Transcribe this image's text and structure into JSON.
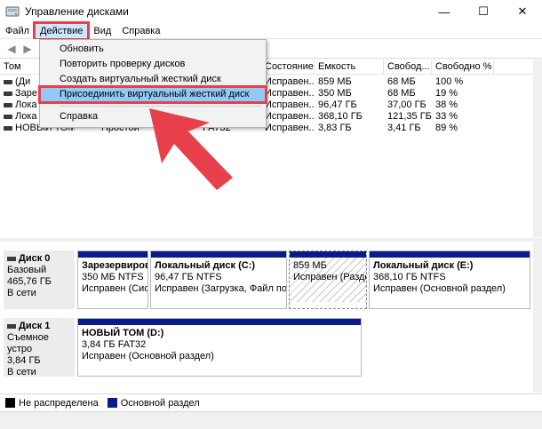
{
  "window": {
    "title": "Управление дисками",
    "icon": "disk-management-icon",
    "buttons": {
      "minimize": "—",
      "maximize": "☐",
      "close": "✕"
    }
  },
  "menubar": {
    "items": [
      "Файл",
      "Действие",
      "Вид",
      "Справка"
    ],
    "active_index": 1
  },
  "toolbar": {
    "back": "◀",
    "forward": "▶"
  },
  "dropdown": {
    "items": [
      "Обновить",
      "Повторить проверку дисков",
      "Создать виртуальный жесткий диск",
      "Присоединить виртуальный жесткий диск",
      "Справка"
    ],
    "highlighted_index": 3
  },
  "volumes": {
    "columns": [
      "Том",
      "",
      "",
      "",
      "Состояние",
      "Емкость",
      "Свобод...",
      "Свободно %"
    ],
    "rows": [
      [
        "(Ди",
        "",
        "",
        "",
        "Исправен...",
        "859 МБ",
        "68 МБ",
        "100 %"
      ],
      [
        "Заре",
        "",
        "",
        "",
        "Исправен...",
        "350 МБ",
        "68 МБ",
        "19 %"
      ],
      [
        "Лока",
        "",
        "",
        "",
        "Исправен...",
        "96,47 ГБ",
        "37,00 ГБ",
        "38 %"
      ],
      [
        "Лока",
        "",
        "",
        "",
        "Исправен...",
        "368,10 ГБ",
        "121,35 ГБ",
        "33 %"
      ],
      [
        "НОВЫЙ ТОМ (D:)",
        "Простой",
        "Базо",
        "FAT32",
        "Исправен...",
        "3,83 ГБ",
        "3,41 ГБ",
        "89 %"
      ]
    ]
  },
  "disks": [
    {
      "name": "Диск 0",
      "type": "Базовый",
      "size": "465,76 ГБ",
      "status": "В сети",
      "partitions": [
        {
          "name": "Зарезервиров",
          "size": "350 МБ NTFS",
          "status": "Исправен (Сис"
        },
        {
          "name": "Локальный диск  (C:)",
          "size": "96,47 ГБ NTFS",
          "status": "Исправен (Загрузка, Файл подкач"
        },
        {
          "name": "",
          "size": "859 МБ",
          "status": "Исправен (Раздел"
        },
        {
          "name": "Локальный диск  (E:)",
          "size": "368,10 ГБ NTFS",
          "status": "Исправен (Основной раздел)"
        }
      ]
    },
    {
      "name": "Диск 1",
      "type": "Съемное устро",
      "size": "3,84 ГБ",
      "status": "В сети",
      "partitions": [
        {
          "name": "НОВЫЙ ТОМ  (D:)",
          "size": "3,84 ГБ FAT32",
          "status": "Исправен (Основной раздел)"
        }
      ]
    }
  ],
  "legend": {
    "items": [
      {
        "label": "Не распределена",
        "color": "#000000"
      },
      {
        "label": "Основной раздел",
        "color": "#0a1a8a"
      }
    ]
  },
  "colors": {
    "highlight_outline": "#e8404a",
    "menu_highlight": "#91c9f7",
    "partition_bar": "#0a1a8a",
    "arrow": "#e8404a"
  }
}
